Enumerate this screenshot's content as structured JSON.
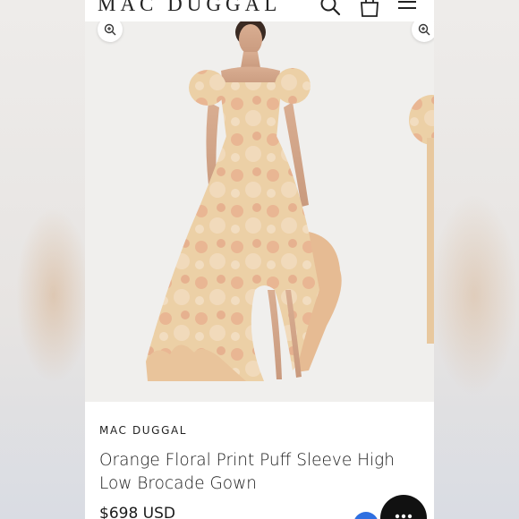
{
  "header": {
    "logo": "MAC DUGGAL"
  },
  "icons": {
    "search": "search-icon",
    "bag": "shopping-bag-icon",
    "menu": "hamburger-menu-icon",
    "zoom": "zoom-in-icon",
    "chat": "chat-icon"
  },
  "product": {
    "brand": "MAC DUGGAL",
    "title": "Orange Floral Print Puff Sleeve High Low Brocade Gown",
    "price": "$698 USD"
  },
  "colors": {
    "gown_base": "#e9c9a0",
    "gown_floral": "#e7a98a",
    "accent_blue": "#2f6fe0"
  }
}
